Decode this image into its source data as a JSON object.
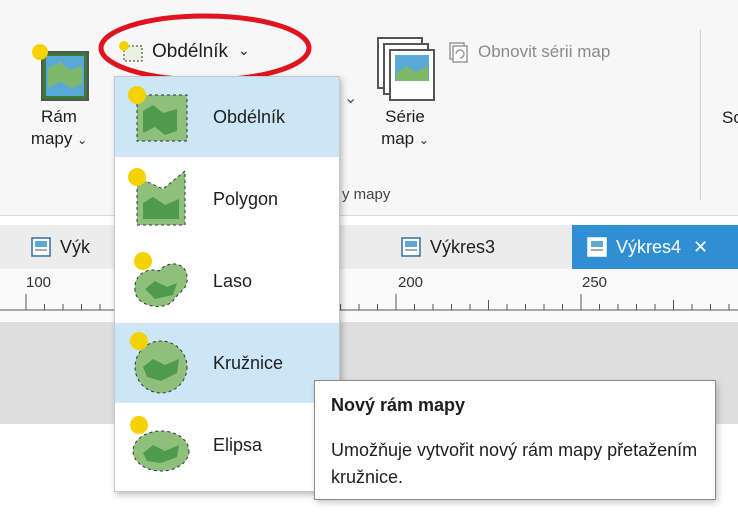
{
  "ribbon": {
    "shape_dropdown_label": "Obdélník",
    "refresh_series_label": "Obnovit sérii map",
    "map_frame_label_line1": "Rám",
    "map_frame_label_line2": "mapy",
    "map_series_label_line1": "Série",
    "map_series_label_line2": "map",
    "group_label_partial": "y mapy",
    "right_partial_label": "Sc"
  },
  "tabs": [
    {
      "label": "Výk"
    },
    {
      "label": "Výkres3"
    },
    {
      "label": "Výkres4",
      "active": true
    }
  ],
  "ruler": {
    "labels": [
      "100",
      "200",
      "250"
    ]
  },
  "menu": {
    "items": [
      {
        "label": "Obdélník",
        "icon": "rectangle-frame-icon",
        "selected": true
      },
      {
        "label": "Polygon",
        "icon": "polygon-frame-icon",
        "selected": false
      },
      {
        "label": "Laso",
        "icon": "lasso-frame-icon",
        "selected": false
      },
      {
        "label": "Kružnice",
        "icon": "circle-frame-icon",
        "selected": true
      },
      {
        "label": "Elipsa",
        "icon": "ellipse-frame-icon",
        "selected": false
      }
    ]
  },
  "tooltip": {
    "title": "Nový rám mapy",
    "body": "Umožňuje vytvořit nový rám mapy přetažením kružnice."
  },
  "colors": {
    "accent": "#2f8fd2",
    "highlight_circle": "#e0141e",
    "selection": "#cde6f7"
  }
}
